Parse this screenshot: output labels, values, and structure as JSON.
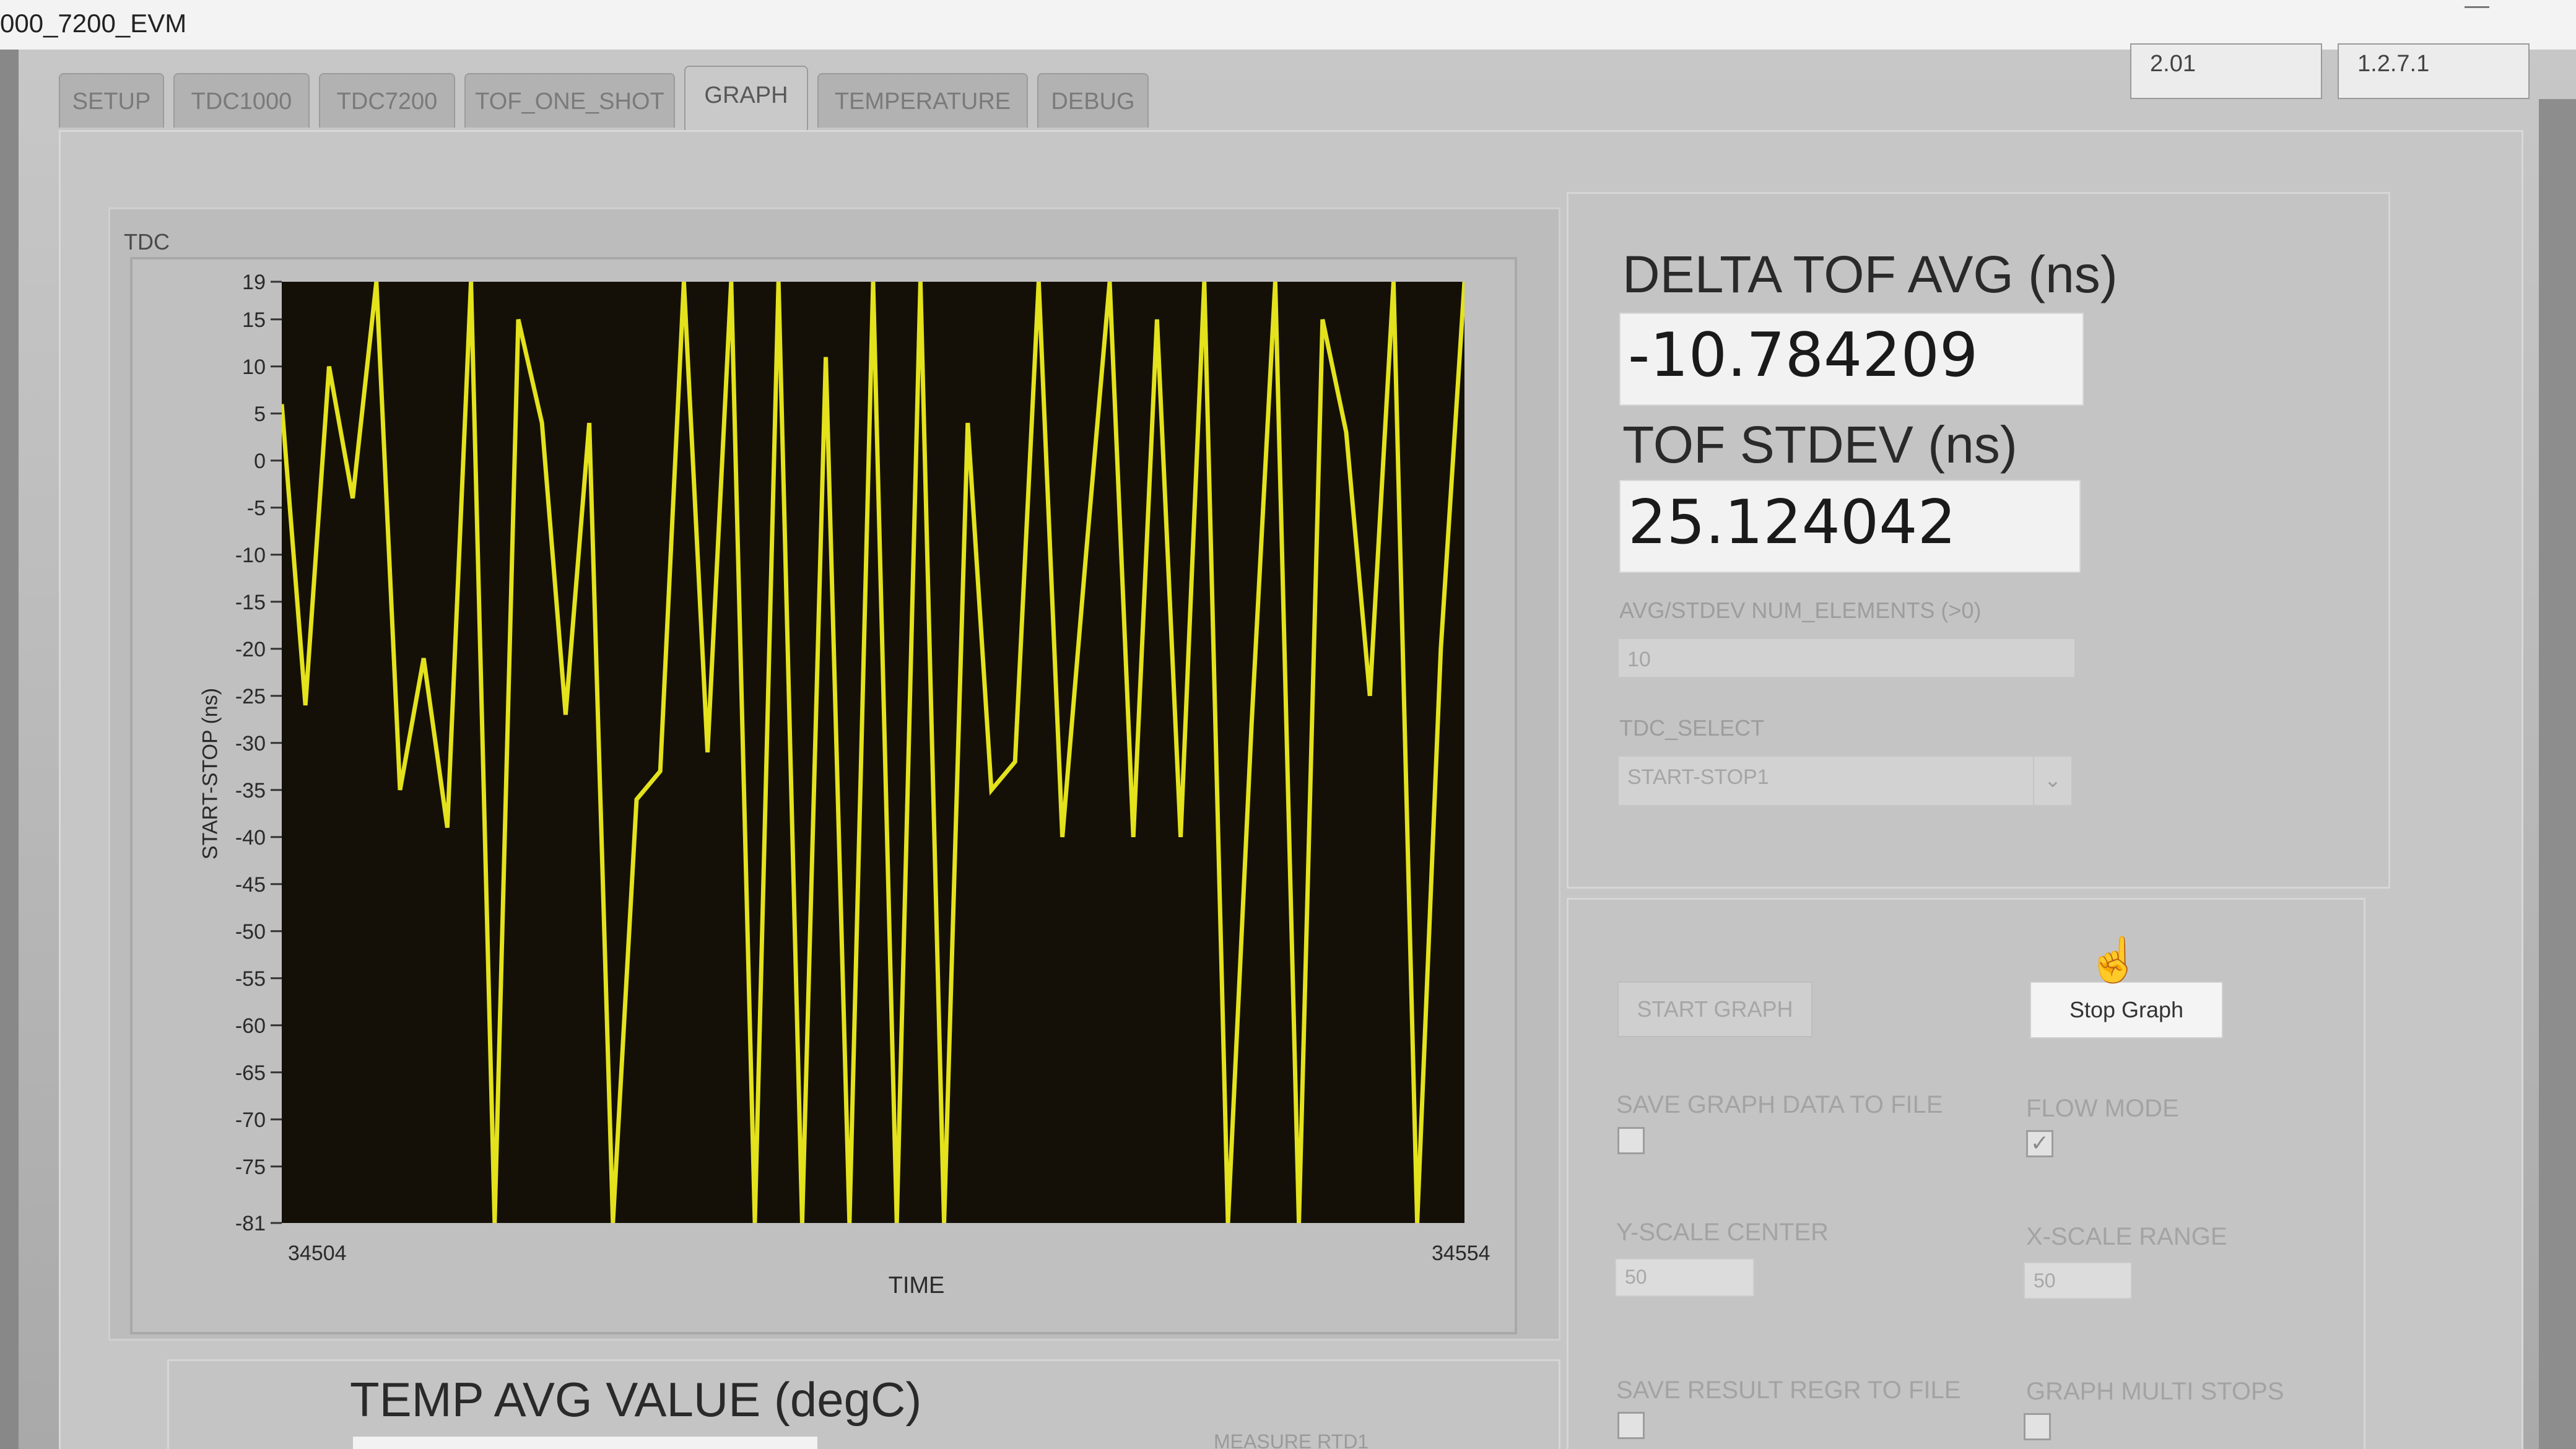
{
  "window": {
    "title": "000_7200_EVM",
    "version_left": "2.01",
    "version_right": "1.2.7.1"
  },
  "tabs": [
    {
      "label": "SETUP",
      "active": false
    },
    {
      "label": "TDC1000",
      "active": false
    },
    {
      "label": "TDC7200",
      "active": false
    },
    {
      "label": "TOF_ONE_SHOT",
      "active": false
    },
    {
      "label": "GRAPH",
      "active": true
    },
    {
      "label": "TEMPERATURE",
      "active": false
    },
    {
      "label": "DEBUG",
      "active": false
    }
  ],
  "graph": {
    "caption": "TDC",
    "colors": {
      "plot_bg": "#141008",
      "trace": "#e3e21c"
    }
  },
  "chart_data": {
    "type": "line",
    "title": "",
    "xlabel": "TIME",
    "ylabel": "START-STOP (ns)",
    "xlim": [
      34504,
      34554
    ],
    "ylim": [
      -81,
      19
    ],
    "x_tick_labels": [
      "34504",
      "34554"
    ],
    "y_ticks": [
      "19",
      "15",
      "10",
      "5",
      "0",
      "-5",
      "-10",
      "-15",
      "-20",
      "-25",
      "-30",
      "-35",
      "-40",
      "-45",
      "-50",
      "-55",
      "-60",
      "-65",
      "-70",
      "-75",
      "-81"
    ],
    "grid": false,
    "series": [
      {
        "x": [
          34504,
          34505,
          34506,
          34507,
          34508,
          34509,
          34510,
          34511,
          34512,
          34513,
          34514,
          34515,
          34516,
          34517,
          34518,
          34519,
          34520,
          34521,
          34522,
          34523,
          34524,
          34525,
          34526,
          34527,
          34528,
          34529,
          34530,
          34531,
          34532,
          34533,
          34534,
          34535,
          34536,
          34537,
          34538,
          34539,
          34540,
          34541,
          34542,
          34543,
          34544,
          34545,
          34546,
          34547,
          34548,
          34549,
          34550,
          34551,
          34552,
          34553,
          34554
        ],
        "y": [
          6,
          -26,
          10,
          -4,
          19,
          -35,
          -21,
          -39,
          19,
          -81,
          15,
          4,
          -27,
          4,
          -81,
          -36,
          -33,
          19,
          -31,
          19,
          -81,
          19,
          -81,
          11,
          -81,
          19,
          -81,
          19,
          -81,
          4,
          -35,
          -32,
          19,
          -40,
          -10,
          19,
          -40,
          15,
          -40,
          19,
          -81,
          -28,
          19,
          -81,
          15,
          3,
          -25,
          19,
          -81,
          -20,
          19
        ]
      }
    ]
  },
  "results": {
    "delta_label": "DELTA TOF AVG (ns)",
    "delta_value": "-10.784209",
    "stdev_label": "TOF STDEV (ns)",
    "stdev_value": "25.124042",
    "num_elements_label": "AVG/STDEV NUM_ELEMENTS (>0)",
    "num_elements_value": "10",
    "tdc_select_label": "TDC_SELECT",
    "tdc_select_value": "START-STOP1"
  },
  "controls": {
    "start_graph": "START GRAPH",
    "stop_graph": "Stop Graph",
    "save_graph_label": "SAVE GRAPH DATA TO FILE",
    "flow_mode_label": "FLOW MODE",
    "y_scale_label": "Y-SCALE CENTER",
    "y_scale_value": "50",
    "x_scale_label": "X-SCALE RANGE",
    "x_scale_value": "50",
    "save_result_label": "SAVE RESULT REGR TO FILE",
    "graph_multi_label": "GRAPH MULTI STOPS"
  },
  "temperature": {
    "avg_label": "TEMP AVG VALUE (degC)",
    "measure_label": "MEASURE RTD1"
  }
}
